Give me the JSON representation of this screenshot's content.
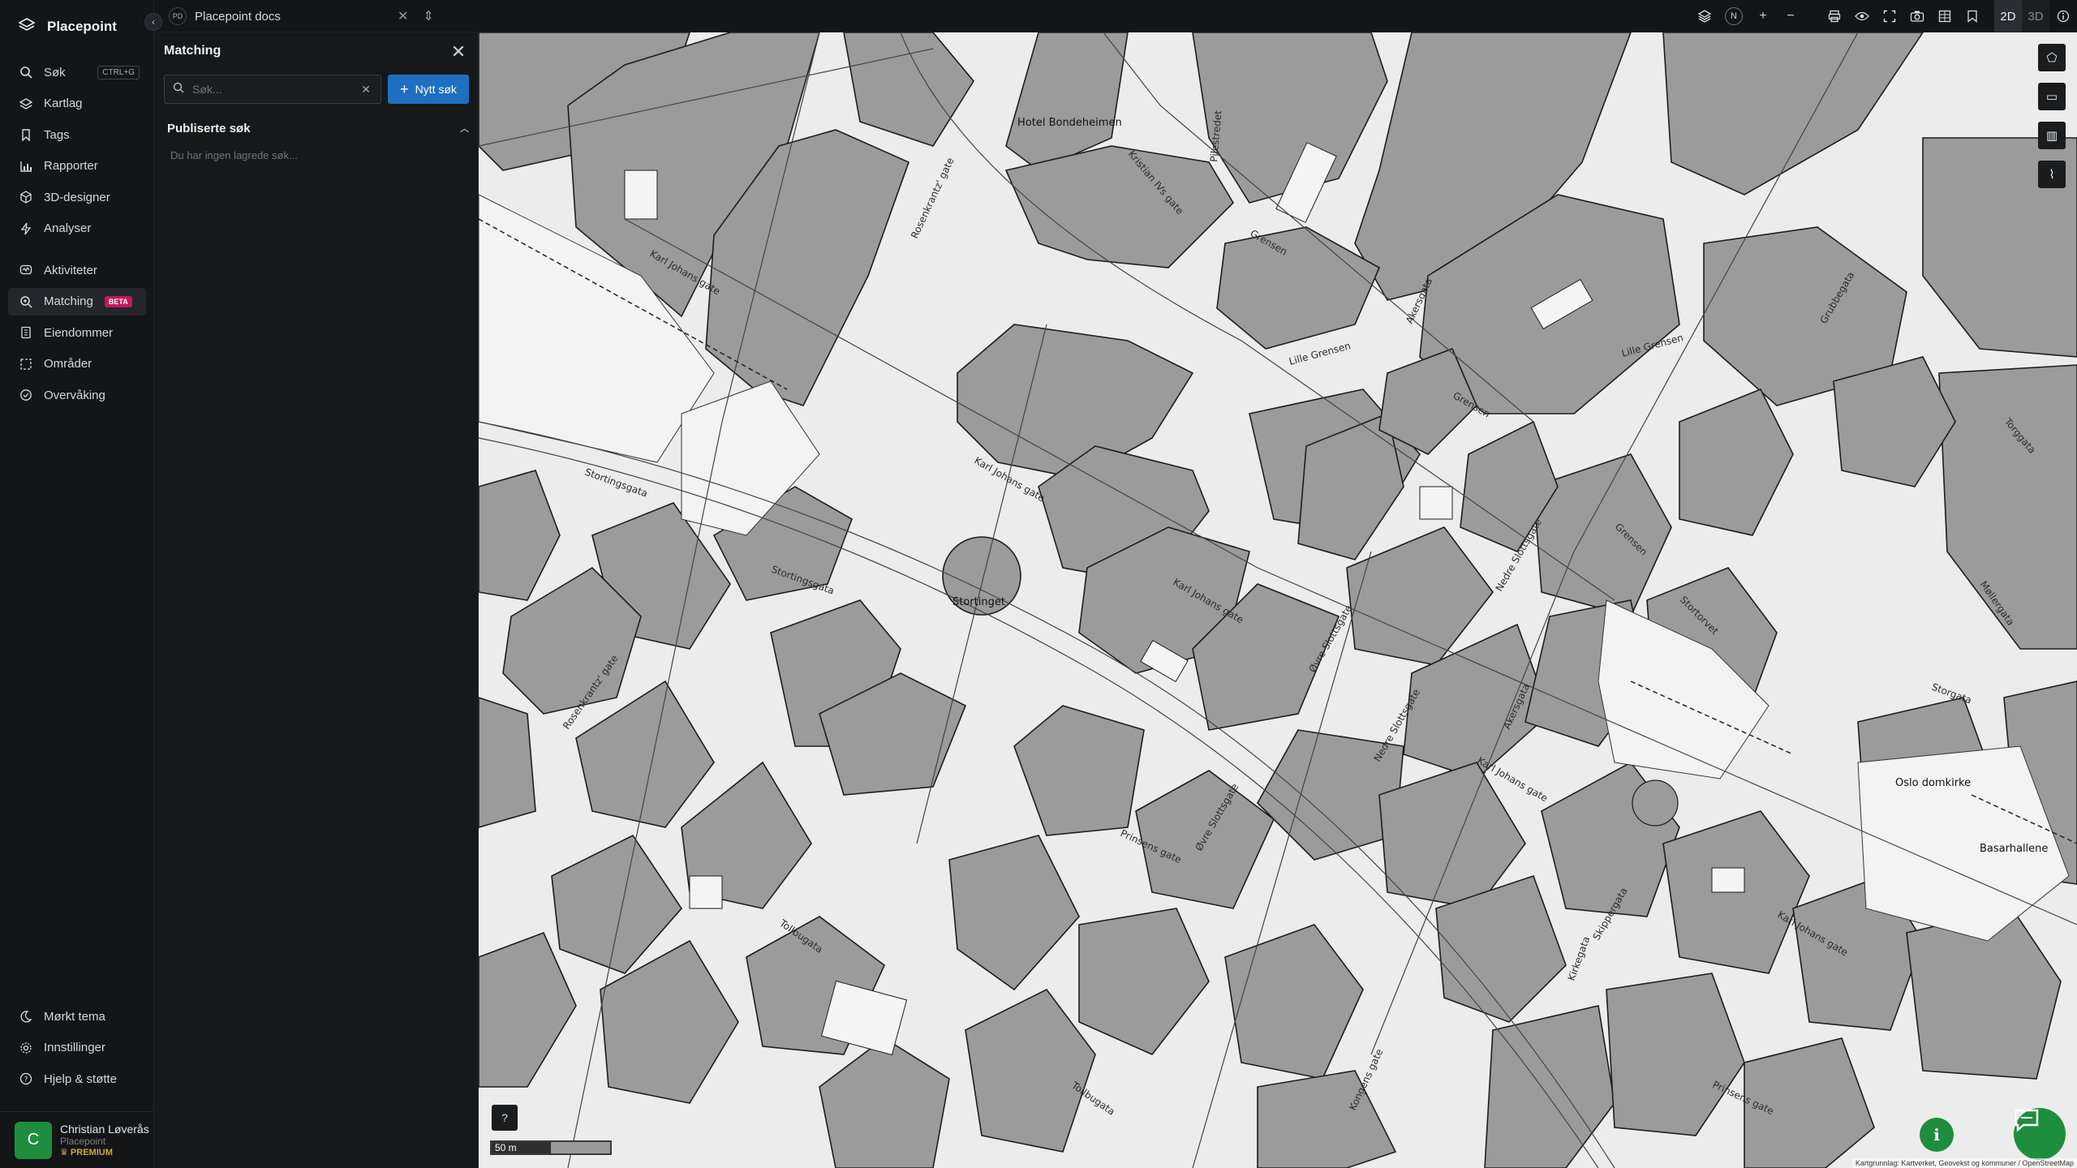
{
  "brand": {
    "name": "Placepoint"
  },
  "workspace": {
    "badge": "PD",
    "name": "Placepoint docs"
  },
  "nav_main": [
    {
      "label": "Søk",
      "icon": "search-icon",
      "shortcut": "CTRL+G"
    },
    {
      "label": "Kartlag",
      "icon": "layers-icon"
    },
    {
      "label": "Tags",
      "icon": "bookmark-icon"
    },
    {
      "label": "Rapporter",
      "icon": "bar-chart-icon"
    },
    {
      "label": "3D-designer",
      "icon": "cube-icon"
    },
    {
      "label": "Analyser",
      "icon": "lightning-icon"
    }
  ],
  "nav_secondary": [
    {
      "label": "Aktiviteter",
      "icon": "activity-icon"
    },
    {
      "label": "Matching",
      "icon": "match-search-icon",
      "badge": "BETA",
      "active": true
    },
    {
      "label": "Eiendommer",
      "icon": "property-icon"
    },
    {
      "label": "Områder",
      "icon": "area-icon"
    },
    {
      "label": "Overvåking",
      "icon": "monitor-icon"
    }
  ],
  "nav_bottom": [
    {
      "label": "Mørkt tema",
      "icon": "moon-icon"
    },
    {
      "label": "Innstillinger",
      "icon": "gear-icon"
    },
    {
      "label": "Hjelp & støtte",
      "icon": "help-icon"
    }
  ],
  "user": {
    "initial": "C",
    "name": "Christian Løverås",
    "org": "Placepoint",
    "plan": "PREMIUM"
  },
  "panel": {
    "title": "Matching",
    "search_placeholder": "Søk...",
    "new_button": "Nytt søk",
    "section_title": "Publiserte søk",
    "empty_text": "Du har ingen lagrede søk..."
  },
  "toolbar": {
    "north": "N",
    "mode_2d": "2D",
    "mode_3d": "3D"
  },
  "map": {
    "scale": "50 m",
    "attribution": "Kartgrunnlag: Kartverket, Geovekst og kommuner / OpenStreetMap",
    "labels": {
      "hotel": "Hotel Bondeheimen",
      "stortinget": "Stortinget",
      "domkirke": "Oslo domkirke",
      "basar": "Basarhallene"
    },
    "streets": {
      "karl_johan": "Karl Johans gate",
      "grensen": "Grensen",
      "lille_grensen": "Lille Grensen",
      "stortingsgata": "Stortingsgata",
      "prinsens": "Prinsens gate",
      "tollbugata": "Tollbugata",
      "ovre_slottsgate": "Øvre Slottsgate",
      "nedre_slottsgate": "Nedre Slottsgate",
      "akersgata": "Akersgata",
      "rosenkrantz": "Rosenkrantz' gate",
      "kristian_iv": "Kristian IVs gate",
      "stortorvet": "Stortorvet",
      "kirkegata": "Kirkegata",
      "torggata": "Torggata",
      "storgata": "Storgata",
      "kongens": "Kongens gate",
      "pilestredet": "Pilestredet",
      "grubbegata": "Grubbegata",
      "mollergata": "Møllergata",
      "skippergata": "Skippergata"
    }
  }
}
